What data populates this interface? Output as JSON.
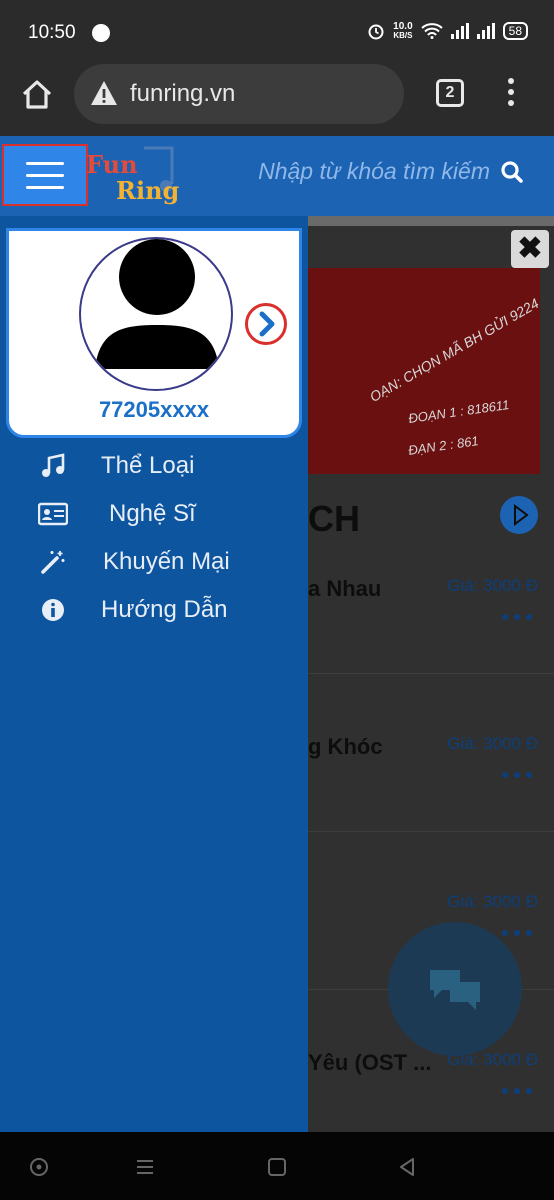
{
  "status_bar": {
    "time": "10:50",
    "speed_value": "10.0",
    "speed_unit": "KB/S",
    "battery": "58"
  },
  "browser": {
    "url": "funring.vn",
    "tab_count": "2"
  },
  "site_header": {
    "logo_fun": "Fun",
    "logo_ring": "Ring",
    "search_placeholder": "Nhập từ khóa tìm kiếm"
  },
  "drawer": {
    "phone_number": "77205xxxx",
    "menu_items": [
      {
        "label": "Thể Loại",
        "icon": "music-note-icon"
      },
      {
        "label": "Nghệ Sĩ",
        "icon": "id-card-icon"
      },
      {
        "label": "Khuyến Mại",
        "icon": "magic-wand-icon"
      },
      {
        "label": "Hướng Dẫn",
        "icon": "info-icon"
      }
    ]
  },
  "background_page": {
    "banner_text_1": "OẠN: CHỌN MÃ BH GỬI 9224",
    "banner_text_2": "ĐOẠN 1 : 818611",
    "banner_text_3": "ĐẠN 2 : 861",
    "section_title": "CH",
    "songs": [
      {
        "name": "a Nhau",
        "price": "Giá: 3000 Đ"
      },
      {
        "name": "g Khóc",
        "price": "Giá: 3000 Đ"
      },
      {
        "name": "",
        "price": "Giá: 3000 Đ"
      },
      {
        "name": "Yêu (OST ...",
        "price": "Giá: 3000 Đ"
      }
    ]
  },
  "colors": {
    "drawer_bg": "#0e55a0",
    "header_bg": "#1d63b4",
    "accent": "#2f86e8",
    "highlight_border": "#d9302c"
  }
}
